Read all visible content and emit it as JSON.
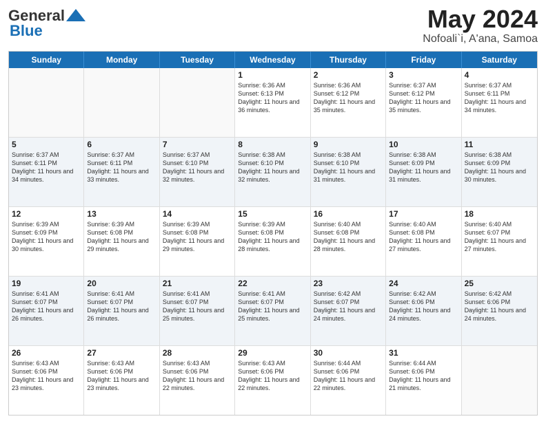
{
  "header": {
    "logo_line1": "General",
    "logo_line2": "Blue",
    "title": "May 2024",
    "subtitle": "Nofoali`i, A'ana, Samoa"
  },
  "calendar": {
    "days_of_week": [
      "Sunday",
      "Monday",
      "Tuesday",
      "Wednesday",
      "Thursday",
      "Friday",
      "Saturday"
    ],
    "weeks": [
      [
        {
          "day": "",
          "sunrise": "",
          "sunset": "",
          "daylight": "",
          "empty": true
        },
        {
          "day": "",
          "sunrise": "",
          "sunset": "",
          "daylight": "",
          "empty": true
        },
        {
          "day": "",
          "sunrise": "",
          "sunset": "",
          "daylight": "",
          "empty": true
        },
        {
          "day": "1",
          "sunrise": "Sunrise: 6:36 AM",
          "sunset": "Sunset: 6:13 PM",
          "daylight": "Daylight: 11 hours and 36 minutes.",
          "empty": false
        },
        {
          "day": "2",
          "sunrise": "Sunrise: 6:36 AM",
          "sunset": "Sunset: 6:12 PM",
          "daylight": "Daylight: 11 hours and 35 minutes.",
          "empty": false
        },
        {
          "day": "3",
          "sunrise": "Sunrise: 6:37 AM",
          "sunset": "Sunset: 6:12 PM",
          "daylight": "Daylight: 11 hours and 35 minutes.",
          "empty": false
        },
        {
          "day": "4",
          "sunrise": "Sunrise: 6:37 AM",
          "sunset": "Sunset: 6:11 PM",
          "daylight": "Daylight: 11 hours and 34 minutes.",
          "empty": false
        }
      ],
      [
        {
          "day": "5",
          "sunrise": "Sunrise: 6:37 AM",
          "sunset": "Sunset: 6:11 PM",
          "daylight": "Daylight: 11 hours and 34 minutes.",
          "empty": false
        },
        {
          "day": "6",
          "sunrise": "Sunrise: 6:37 AM",
          "sunset": "Sunset: 6:11 PM",
          "daylight": "Daylight: 11 hours and 33 minutes.",
          "empty": false
        },
        {
          "day": "7",
          "sunrise": "Sunrise: 6:37 AM",
          "sunset": "Sunset: 6:10 PM",
          "daylight": "Daylight: 11 hours and 32 minutes.",
          "empty": false
        },
        {
          "day": "8",
          "sunrise": "Sunrise: 6:38 AM",
          "sunset": "Sunset: 6:10 PM",
          "daylight": "Daylight: 11 hours and 32 minutes.",
          "empty": false
        },
        {
          "day": "9",
          "sunrise": "Sunrise: 6:38 AM",
          "sunset": "Sunset: 6:10 PM",
          "daylight": "Daylight: 11 hours and 31 minutes.",
          "empty": false
        },
        {
          "day": "10",
          "sunrise": "Sunrise: 6:38 AM",
          "sunset": "Sunset: 6:09 PM",
          "daylight": "Daylight: 11 hours and 31 minutes.",
          "empty": false
        },
        {
          "day": "11",
          "sunrise": "Sunrise: 6:38 AM",
          "sunset": "Sunset: 6:09 PM",
          "daylight": "Daylight: 11 hours and 30 minutes.",
          "empty": false
        }
      ],
      [
        {
          "day": "12",
          "sunrise": "Sunrise: 6:39 AM",
          "sunset": "Sunset: 6:09 PM",
          "daylight": "Daylight: 11 hours and 30 minutes.",
          "empty": false
        },
        {
          "day": "13",
          "sunrise": "Sunrise: 6:39 AM",
          "sunset": "Sunset: 6:08 PM",
          "daylight": "Daylight: 11 hours and 29 minutes.",
          "empty": false
        },
        {
          "day": "14",
          "sunrise": "Sunrise: 6:39 AM",
          "sunset": "Sunset: 6:08 PM",
          "daylight": "Daylight: 11 hours and 29 minutes.",
          "empty": false
        },
        {
          "day": "15",
          "sunrise": "Sunrise: 6:39 AM",
          "sunset": "Sunset: 6:08 PM",
          "daylight": "Daylight: 11 hours and 28 minutes.",
          "empty": false
        },
        {
          "day": "16",
          "sunrise": "Sunrise: 6:40 AM",
          "sunset": "Sunset: 6:08 PM",
          "daylight": "Daylight: 11 hours and 28 minutes.",
          "empty": false
        },
        {
          "day": "17",
          "sunrise": "Sunrise: 6:40 AM",
          "sunset": "Sunset: 6:08 PM",
          "daylight": "Daylight: 11 hours and 27 minutes.",
          "empty": false
        },
        {
          "day": "18",
          "sunrise": "Sunrise: 6:40 AM",
          "sunset": "Sunset: 6:07 PM",
          "daylight": "Daylight: 11 hours and 27 minutes.",
          "empty": false
        }
      ],
      [
        {
          "day": "19",
          "sunrise": "Sunrise: 6:41 AM",
          "sunset": "Sunset: 6:07 PM",
          "daylight": "Daylight: 11 hours and 26 minutes.",
          "empty": false
        },
        {
          "day": "20",
          "sunrise": "Sunrise: 6:41 AM",
          "sunset": "Sunset: 6:07 PM",
          "daylight": "Daylight: 11 hours and 26 minutes.",
          "empty": false
        },
        {
          "day": "21",
          "sunrise": "Sunrise: 6:41 AM",
          "sunset": "Sunset: 6:07 PM",
          "daylight": "Daylight: 11 hours and 25 minutes.",
          "empty": false
        },
        {
          "day": "22",
          "sunrise": "Sunrise: 6:41 AM",
          "sunset": "Sunset: 6:07 PM",
          "daylight": "Daylight: 11 hours and 25 minutes.",
          "empty": false
        },
        {
          "day": "23",
          "sunrise": "Sunrise: 6:42 AM",
          "sunset": "Sunset: 6:07 PM",
          "daylight": "Daylight: 11 hours and 24 minutes.",
          "empty": false
        },
        {
          "day": "24",
          "sunrise": "Sunrise: 6:42 AM",
          "sunset": "Sunset: 6:06 PM",
          "daylight": "Daylight: 11 hours and 24 minutes.",
          "empty": false
        },
        {
          "day": "25",
          "sunrise": "Sunrise: 6:42 AM",
          "sunset": "Sunset: 6:06 PM",
          "daylight": "Daylight: 11 hours and 24 minutes.",
          "empty": false
        }
      ],
      [
        {
          "day": "26",
          "sunrise": "Sunrise: 6:43 AM",
          "sunset": "Sunset: 6:06 PM",
          "daylight": "Daylight: 11 hours and 23 minutes.",
          "empty": false
        },
        {
          "day": "27",
          "sunrise": "Sunrise: 6:43 AM",
          "sunset": "Sunset: 6:06 PM",
          "daylight": "Daylight: 11 hours and 23 minutes.",
          "empty": false
        },
        {
          "day": "28",
          "sunrise": "Sunrise: 6:43 AM",
          "sunset": "Sunset: 6:06 PM",
          "daylight": "Daylight: 11 hours and 22 minutes.",
          "empty": false
        },
        {
          "day": "29",
          "sunrise": "Sunrise: 6:43 AM",
          "sunset": "Sunset: 6:06 PM",
          "daylight": "Daylight: 11 hours and 22 minutes.",
          "empty": false
        },
        {
          "day": "30",
          "sunrise": "Sunrise: 6:44 AM",
          "sunset": "Sunset: 6:06 PM",
          "daylight": "Daylight: 11 hours and 22 minutes.",
          "empty": false
        },
        {
          "day": "31",
          "sunrise": "Sunrise: 6:44 AM",
          "sunset": "Sunset: 6:06 PM",
          "daylight": "Daylight: 11 hours and 21 minutes.",
          "empty": false
        },
        {
          "day": "",
          "sunrise": "",
          "sunset": "",
          "daylight": "",
          "empty": true
        }
      ]
    ]
  }
}
